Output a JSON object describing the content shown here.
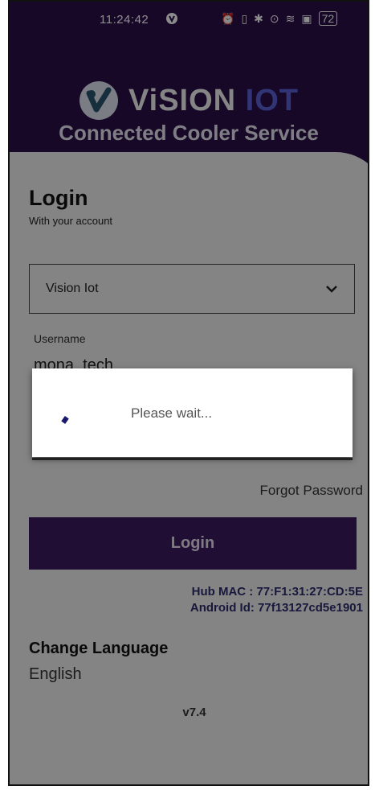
{
  "status_bar": {
    "time": "11:24:42",
    "battery": "72",
    "icons": [
      "shield-icon",
      "alarm-icon",
      "vibrate-icon",
      "bluetooth-icon",
      "location-icon",
      "wifi-icon",
      "screenshot-icon",
      "battery-icon"
    ]
  },
  "brand": {
    "name_part1": "ViSION",
    "name_part2": "IOT",
    "subtitle": "Connected Cooler Service",
    "accent": "#5a62d6",
    "background": "#2a0f4a"
  },
  "login": {
    "title": "Login",
    "subtitle": "With your account",
    "organization": "Vision Iot",
    "username_label": "Username",
    "username_value": "mona_tech",
    "forgot_password": "Forgot Password",
    "button": "Login",
    "button_color": "#3b1a61"
  },
  "device": {
    "hub_mac": "Hub MAC : 77:F1:31:27:CD:5E",
    "android_id": "Android Id: 77f13127cd5e1901"
  },
  "language": {
    "label": "Change Language",
    "value": "English"
  },
  "version": "v7.4",
  "dialog": {
    "message": "Please wait..."
  }
}
